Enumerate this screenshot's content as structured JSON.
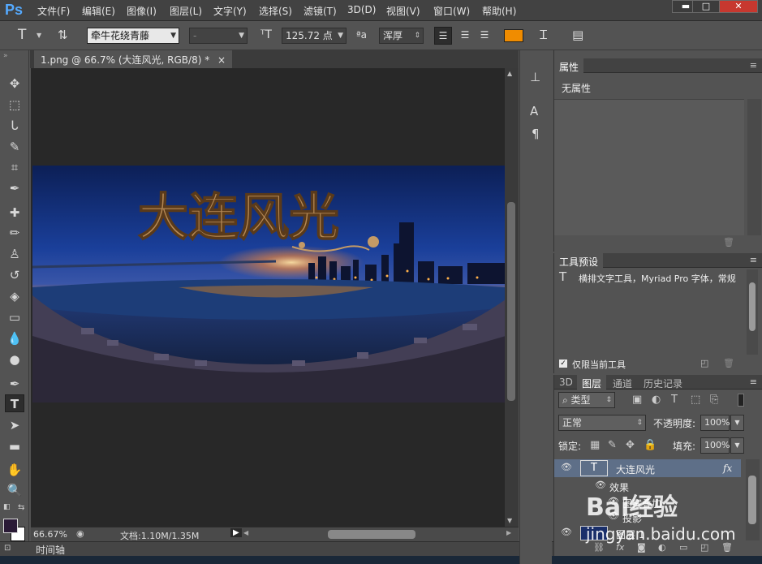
{
  "app": {
    "logo": "Ps"
  },
  "menu": [
    "文件(F)",
    "编辑(E)",
    "图像(I)",
    "图层(L)",
    "文字(Y)",
    "选择(S)",
    "滤镜(T)",
    "3D(D)",
    "视图(V)",
    "窗口(W)",
    "帮助(H)"
  ],
  "window_buttons": {
    "minimize": "▬",
    "restore": "□",
    "close": "✕"
  },
  "options": {
    "tool_glyph": "T",
    "font_family": "牵牛花绕青藤",
    "font_style": "-",
    "font_size": "125.72 点",
    "aa_label": "ªa",
    "antialias": "浑厚",
    "text_color": "#f08c00"
  },
  "document": {
    "tab_title": "1.png @ 66.7% (大连风光, RGB/8) *",
    "close": "×",
    "artwork_text": "大连风光"
  },
  "status": {
    "zoom": "66.67%",
    "doc_info": "文档:1.10M/1.35M"
  },
  "timeline": {
    "label": "时间轴"
  },
  "properties": {
    "tab": "属性",
    "content": "无属性"
  },
  "tool_presets": {
    "tab": "工具预设",
    "item": "横排文字工具，Myriad Pro 字体，常规",
    "only_current": "仅限当前工具"
  },
  "layers": {
    "tabs": [
      "3D",
      "图层",
      "通道",
      "历史记录"
    ],
    "filter_kind": "类型",
    "blend_mode": "正常",
    "opacity_label": "不透明度:",
    "opacity": "100%",
    "lock_label": "锁定:",
    "fill_label": "填充:",
    "fill": "100%",
    "items": [
      {
        "name": "大连风光",
        "fx": "fx"
      },
      {
        "name": "效果"
      },
      {
        "name": "图案叠加"
      },
      {
        "name": "投影"
      },
      {
        "name": "图层 1"
      }
    ]
  },
  "watermark": {
    "brand": "Bai经验",
    "url": "jingyan.baidu.com"
  },
  "colors": {
    "foreground": "#2a1a36",
    "background": "#ffffff"
  }
}
